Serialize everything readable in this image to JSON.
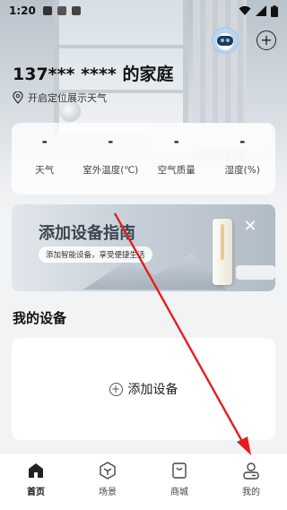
{
  "status_bar": {
    "time": "1:20"
  },
  "header": {
    "home_title": "137*** **** 的家庭",
    "location_text": "开启定位展示天气"
  },
  "weather": [
    {
      "value": "-",
      "label": "天气"
    },
    {
      "value": "-",
      "label": "室外温度(℃)"
    },
    {
      "value": "-",
      "label": "空气质量"
    },
    {
      "value": "-",
      "label": "湿度(%)"
    }
  ],
  "guide_banner": {
    "title": "添加设备指南",
    "subtitle": "添加智能设备，享受便捷生活"
  },
  "my_devices": {
    "section_title": "我的设备",
    "add_device_label": "添加设备"
  },
  "bottom_nav": [
    {
      "label": "首页",
      "icon": "home-icon",
      "active": true
    },
    {
      "label": "场景",
      "icon": "scene-icon",
      "active": false
    },
    {
      "label": "商城",
      "icon": "shop-bag-icon",
      "active": false
    },
    {
      "label": "我的",
      "icon": "profile-icon",
      "active": false
    }
  ],
  "colors": {
    "annotation_arrow": "#e02020",
    "background": "#f2f3f5"
  }
}
